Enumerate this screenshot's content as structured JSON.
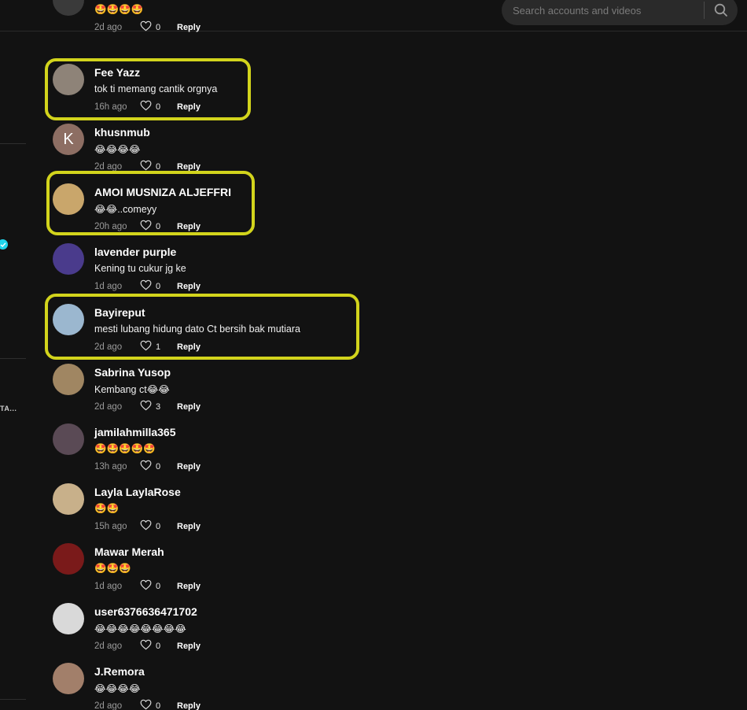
{
  "search": {
    "placeholder": "Search accounts and videos",
    "icon": "search-icon"
  },
  "left_panel": {
    "truncated_label": "TA...",
    "verified_color": "#20d5ec"
  },
  "highlight_color": "#d2d41c",
  "comments": [
    {
      "username": "",
      "text": "🤩🤩🤩🤩",
      "time": "2d ago",
      "likes": "0",
      "reply": "Reply",
      "avatar_color": "#3a3a3a",
      "avatar_letter": ""
    },
    {
      "username": "Fee Yazz",
      "text": "tok ti memang cantik orgnya",
      "time": "16h ago",
      "likes": "0",
      "reply": "Reply",
      "avatar_color": "#8e8378",
      "avatar_letter": ""
    },
    {
      "username": "khusnmub",
      "text": "😂😂😂😂",
      "time": "2d ago",
      "likes": "0",
      "reply": "Reply",
      "avatar_color": "#8d6e63",
      "avatar_letter": "K"
    },
    {
      "username": "AMOI MUSNIZA ALJEFFRI",
      "text": "😂😂..comeyy",
      "time": "20h ago",
      "likes": "0",
      "reply": "Reply",
      "avatar_color": "#c9a66b",
      "avatar_letter": ""
    },
    {
      "username": "lavender purple",
      "text": "Kening tu cukur jg ke",
      "time": "1d ago",
      "likes": "0",
      "reply": "Reply",
      "avatar_color": "#4a3b8c",
      "avatar_letter": ""
    },
    {
      "username": "Bayireput",
      "text": "mesti lubang hidung dato Ct bersih bak mutiara",
      "time": "2d ago",
      "likes": "1",
      "reply": "Reply",
      "avatar_color": "#9bb7cf",
      "avatar_letter": ""
    },
    {
      "username": "Sabrina Yusop",
      "text": "Kembang ct😂😂",
      "time": "2d ago",
      "likes": "3",
      "reply": "Reply",
      "avatar_color": "#a08662",
      "avatar_letter": ""
    },
    {
      "username": "jamilahmilla365",
      "text": "🤩🤩🤩🤩🤩",
      "time": "13h ago",
      "likes": "0",
      "reply": "Reply",
      "avatar_color": "#5a4a55",
      "avatar_letter": ""
    },
    {
      "username": "Layla LaylaRose",
      "text": "🤩🤩",
      "time": "15h ago",
      "likes": "0",
      "reply": "Reply",
      "avatar_color": "#c8b08a",
      "avatar_letter": ""
    },
    {
      "username": "Mawar Merah",
      "text": "🤩🤩🤩",
      "time": "1d ago",
      "likes": "0",
      "reply": "Reply",
      "avatar_color": "#7a1a1a",
      "avatar_letter": ""
    },
    {
      "username": "user6376636471702",
      "text": "😂😂😂😂😂😂😂😂",
      "time": "2d ago",
      "likes": "0",
      "reply": "Reply",
      "avatar_color": "#d9d9d9",
      "avatar_letter": ""
    },
    {
      "username": "J.Remora",
      "text": "😂😂😂😂",
      "time": "2d ago",
      "likes": "0",
      "reply": "Reply",
      "avatar_color": "#a27f6a",
      "avatar_letter": ""
    }
  ]
}
